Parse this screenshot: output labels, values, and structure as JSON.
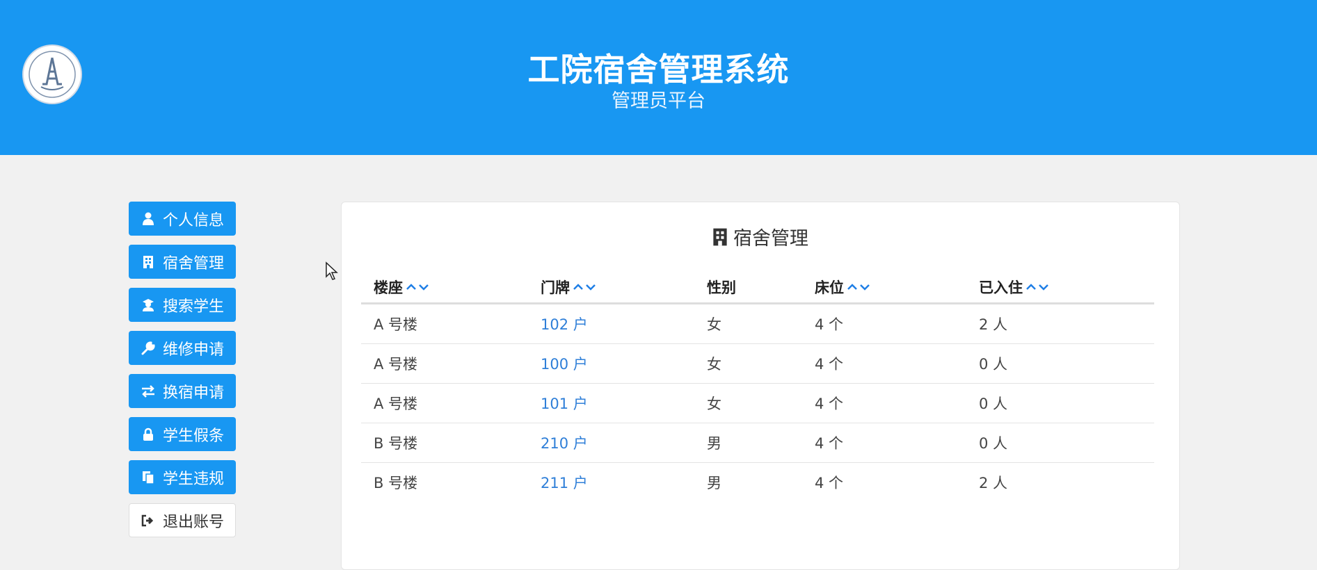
{
  "header": {
    "title": "工院宿舍管理系统",
    "subtitle": "管理员平台"
  },
  "sidebar": {
    "items": [
      {
        "label": "个人信息",
        "icon": "user-icon"
      },
      {
        "label": "宿舍管理",
        "icon": "building-icon"
      },
      {
        "label": "搜索学生",
        "icon": "student-icon"
      },
      {
        "label": "维修申请",
        "icon": "wrench-icon"
      },
      {
        "label": "换宿申请",
        "icon": "swap-icon"
      },
      {
        "label": "学生假条",
        "icon": "lock-icon"
      },
      {
        "label": "学生违规",
        "icon": "copy-icon"
      },
      {
        "label": "退出账号",
        "icon": "sign-out-icon"
      }
    ]
  },
  "panel": {
    "title": "宿舍管理",
    "icon": "building-icon",
    "columns": [
      "楼座",
      "门牌",
      "性别",
      "床位",
      "已入住"
    ],
    "rows": [
      [
        "A 号楼",
        "102 户",
        "女",
        "4 个",
        "2 人"
      ],
      [
        "A 号楼",
        "100 户",
        "女",
        "4 个",
        "0 人"
      ],
      [
        "A 号楼",
        "101 户",
        "女",
        "4 个",
        "0 人"
      ],
      [
        "B 号楼",
        "210 户",
        "男",
        "4 个",
        "0 人"
      ],
      [
        "B 号楼",
        "211 户",
        "男",
        "4 个",
        "2 人"
      ]
    ]
  },
  "colors": {
    "primary": "#1897f2",
    "link": "#2f7fd8",
    "background": "#f1f1f1"
  }
}
